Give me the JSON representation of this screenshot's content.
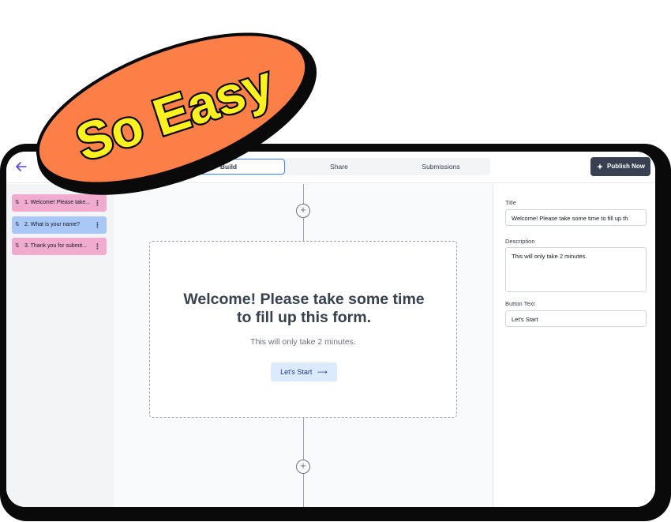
{
  "topbar": {
    "back_icon": "arrow-left-icon",
    "tabs": [
      {
        "label": "Build",
        "active": true
      },
      {
        "label": "Share",
        "active": false
      },
      {
        "label": "Submissions",
        "active": false
      }
    ],
    "publish_label": "Publish Now",
    "publish_icon": "sparkle-icon"
  },
  "sidebar": {
    "steps": [
      {
        "label": "1. Welcome! Please take...",
        "color": "#f0abcf"
      },
      {
        "label": "2. What is your name?",
        "color": "#a9c8f5"
      },
      {
        "label": "3. Thank you for submit...",
        "color": "#f0abcf"
      }
    ],
    "sort_icon": "⇅",
    "menu_icon": "⋮"
  },
  "canvas": {
    "add_icon": "plus-circle-icon",
    "card": {
      "title": "Welcome! Please take some time to fill up this form.",
      "description": "This will only take 2 minutes.",
      "button_label": "Let's Start",
      "button_icon": "⟶"
    }
  },
  "panel": {
    "title_label": "Title",
    "title_value": "Welcome! Please take some time to fill up th",
    "description_label": "Description",
    "description_value": "This will only take 2 minutes.",
    "button_text_label": "Button Text",
    "button_text_value": "Let's Start"
  },
  "badge": {
    "text": "So Easy",
    "fill": "#fd7f48",
    "text_color": "#fdf11f"
  }
}
